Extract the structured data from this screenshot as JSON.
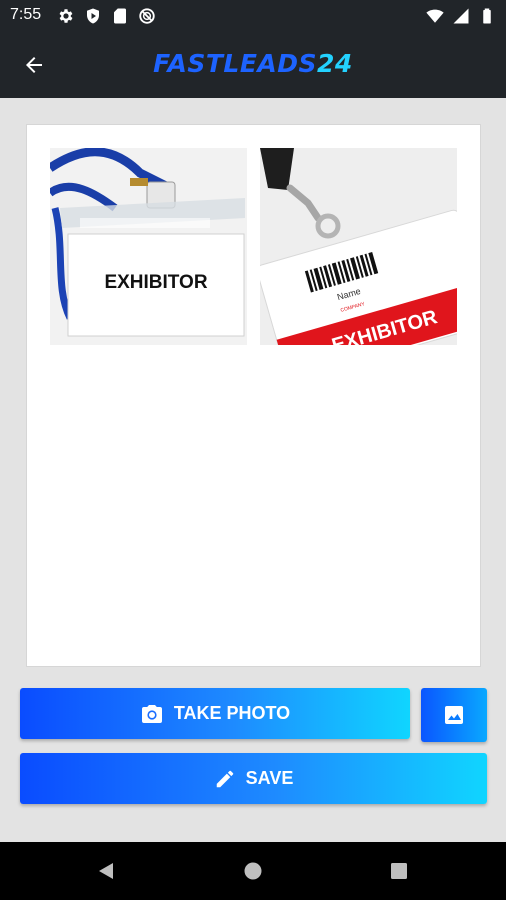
{
  "status_bar": {
    "time": "7:55",
    "left_icons": [
      "gear-icon",
      "play-shield-icon",
      "sd-card-icon",
      "no-entry-icon"
    ],
    "right_icons": [
      "wifi-icon",
      "signal-icon",
      "battery-icon"
    ]
  },
  "toolbar": {
    "brand_main": "FASTLEADS",
    "brand_num": "24",
    "back_icon": "arrow-left-icon"
  },
  "card": {
    "badge_1_text": "EXHIBITOR",
    "badge_2_name": "Name",
    "badge_2_small": "COMPANY",
    "badge_2_text": "EXHIBITOR"
  },
  "buttons": {
    "take_photo_label": "TAKE PHOTO",
    "save_label": "SAVE",
    "gallery_icon": "image-icon"
  },
  "nav": {
    "items": [
      "back-triangle-icon",
      "home-circle-icon",
      "recents-square-icon"
    ]
  },
  "colors": {
    "bar_bg": "#212529",
    "brand_blue": "#1d63ff",
    "brand_cyan": "#23d2ff",
    "button_start": "#0a4cff",
    "button_end": "#10d5ff",
    "badge_red": "#e0151c"
  }
}
